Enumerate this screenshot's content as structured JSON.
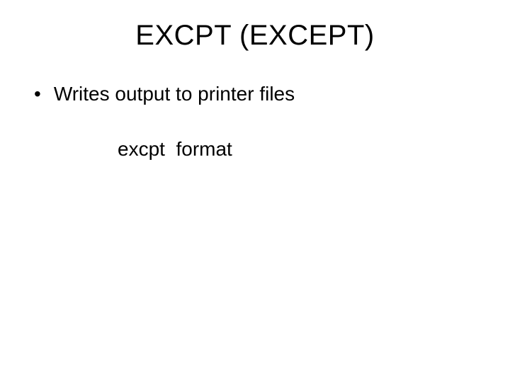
{
  "title": "EXCPT (EXCEPT)",
  "bullet": {
    "marker": "•",
    "text": "Writes output to printer files"
  },
  "sub": "excpt  format"
}
